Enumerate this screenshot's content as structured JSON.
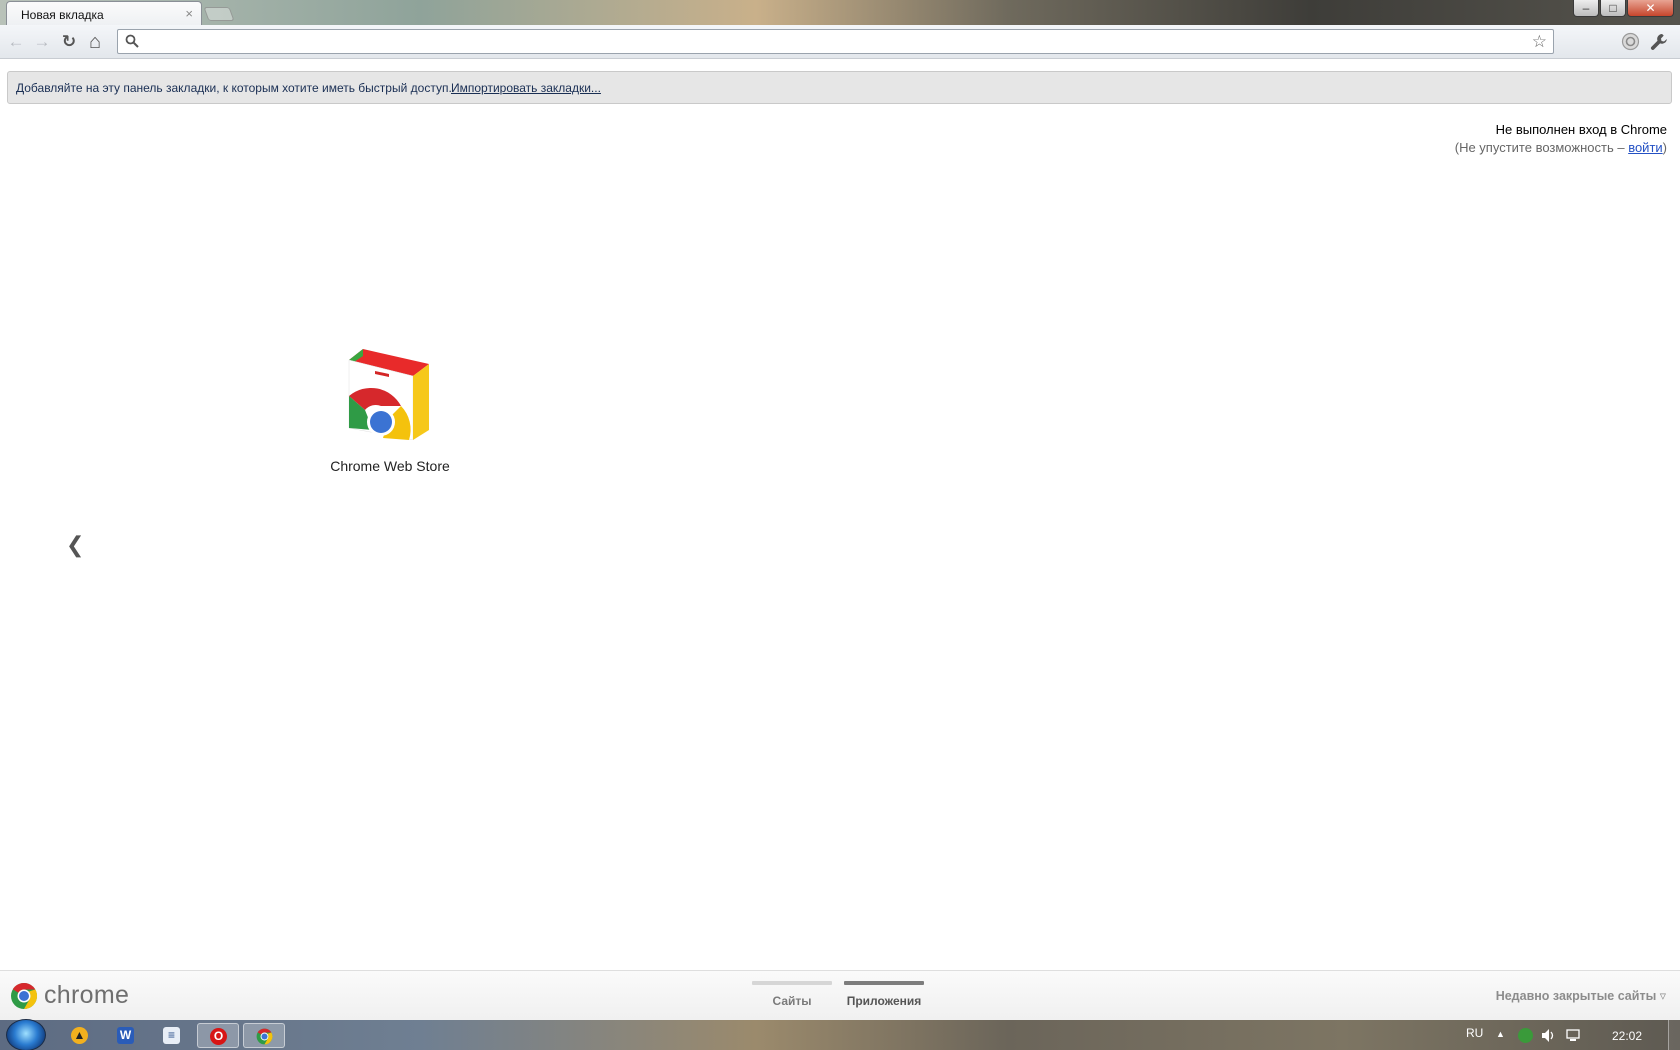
{
  "browser": {
    "tab_title": "Новая вкладка",
    "tab_close": "×",
    "window_controls": {
      "minimize": "–",
      "maximize": "□",
      "close": "✕"
    }
  },
  "toolbar": {
    "back": "←",
    "forward": "→",
    "reload": "↻",
    "home": "⌂",
    "omnibox_value": "",
    "bookmark_star": "☆",
    "wrench": "🔧",
    "sync": "○"
  },
  "bookmarks_bar": {
    "prompt": "Добавляйте на эту панель закладки, к которым хотите иметь быстрый доступ.",
    "import_link": "Импортировать закладки..."
  },
  "signin": {
    "title": "Не выполнен вход в Chrome",
    "sub_prefix": "(Не упустите возможность – ",
    "link": "войти",
    "sub_suffix": ")"
  },
  "apps": [
    {
      "label": "Chrome Web Store",
      "icon": "chrome-web-store-icon"
    }
  ],
  "prev_page_arrow": "❮",
  "footer": {
    "brand": "chrome",
    "pages": [
      {
        "label": "Сайты",
        "active": false
      },
      {
        "label": "Приложения",
        "active": true
      }
    ],
    "recently_closed": "Недавно закрытые сайты ▿"
  },
  "taskbar": {
    "items": [
      "aimp-icon",
      "word-icon",
      "notepad-icon",
      "opera-icon",
      "chrome-icon"
    ],
    "active_item": "chrome-icon",
    "language": "RU",
    "tray_expand": "▲",
    "time": "22:02"
  },
  "colors": {
    "link_blue": "#2451c4",
    "bookmark_text": "#1a2f54",
    "pager_active": "#7d7d7d",
    "pager_inactive": "#d6d6d6"
  }
}
